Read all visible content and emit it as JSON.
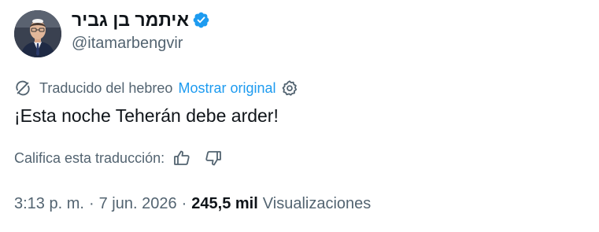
{
  "author": {
    "display_name": "איתמר בן גביר",
    "handle": "@itamarbengvir",
    "verified": true,
    "verified_color": "#1d9bf0"
  },
  "translation": {
    "label": "Traducido del hebreo",
    "show_original": "Mostrar original",
    "link_color": "#1d9bf0"
  },
  "tweet": {
    "text": "¡Esta noche Teherán debe arder!"
  },
  "rating": {
    "label": "Califica esta traducción:"
  },
  "meta": {
    "time": "3:13 p. m.",
    "separator": "·",
    "date": "7 jun. 2026",
    "views_count": "245,5 mil",
    "views_label": "Visualizaciones"
  },
  "icons": {
    "verified": "verified-badge-icon",
    "translate": "translate-icon",
    "settings": "gear-icon",
    "thumb_up": "thumbs-up-icon",
    "thumb_down": "thumbs-down-icon"
  }
}
